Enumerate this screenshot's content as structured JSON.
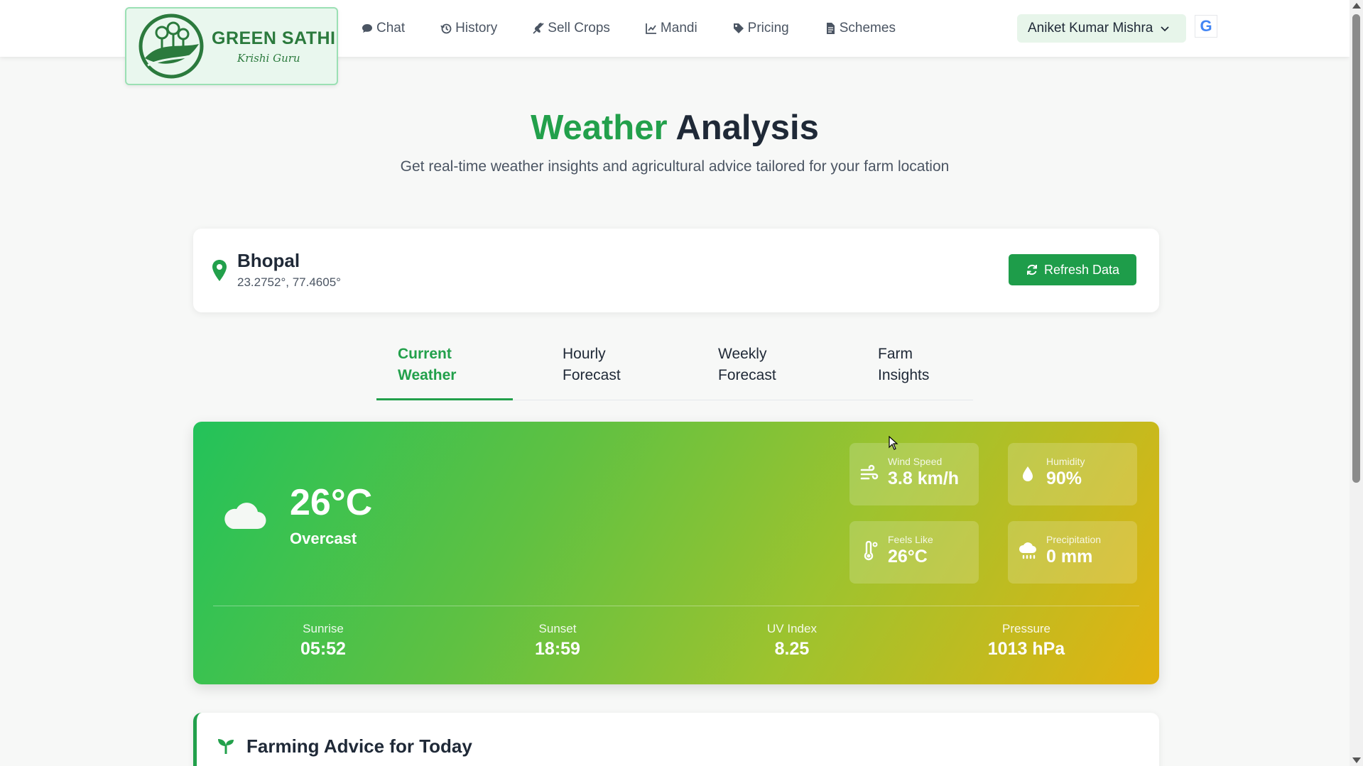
{
  "brand": {
    "title": "GREEN SATHI",
    "subtitle": "Krishi Guru"
  },
  "nav": [
    {
      "label": "Chat",
      "icon": "chat-icon"
    },
    {
      "label": "History",
      "icon": "history-icon"
    },
    {
      "label": "Sell Crops",
      "icon": "seedling-icon"
    },
    {
      "label": "Mandi",
      "icon": "chart-line-icon"
    },
    {
      "label": "Pricing",
      "icon": "tag-icon"
    },
    {
      "label": "Schemes",
      "icon": "document-icon"
    }
  ],
  "user": {
    "name": "Aniket Kumar Mishra",
    "google_glyph": "G"
  },
  "hero": {
    "title_accent": "Weather",
    "title_rest": "Analysis",
    "subtitle": "Get real-time weather insights and agricultural advice tailored for your farm location"
  },
  "location": {
    "name": "Bhopal",
    "coords": "23.2752°, 77.4605°",
    "refresh_label": "Refresh Data"
  },
  "tabs": [
    {
      "label": "Current Weather",
      "active": true
    },
    {
      "label": "Hourly Forecast",
      "active": false
    },
    {
      "label": "Weekly Forecast",
      "active": false
    },
    {
      "label": "Farm Insights",
      "active": false
    }
  ],
  "current": {
    "temperature": "26°C",
    "condition": "Overcast",
    "icon": "cloud-icon",
    "metrics": {
      "wind": {
        "label": "Wind Speed",
        "value": "3.8 km/h"
      },
      "humidity": {
        "label": "Humidity",
        "value": "90%"
      },
      "feels": {
        "label": "Feels Like",
        "value": "26°C"
      },
      "precip": {
        "label": "Precipitation",
        "value": "0 mm"
      }
    },
    "stats": {
      "sunrise": {
        "label": "Sunrise",
        "value": "05:52"
      },
      "sunset": {
        "label": "Sunset",
        "value": "18:59"
      },
      "uv": {
        "label": "UV Index",
        "value": "8.25"
      },
      "pressure": {
        "label": "Pressure",
        "value": "1013 hPa"
      }
    }
  },
  "advice": {
    "title": "Farming Advice for Today"
  },
  "colors": {
    "accent": "#22a04b",
    "button": "#1e9d4a",
    "gradient_start": "#23c25a",
    "gradient_end": "#e3b311"
  }
}
